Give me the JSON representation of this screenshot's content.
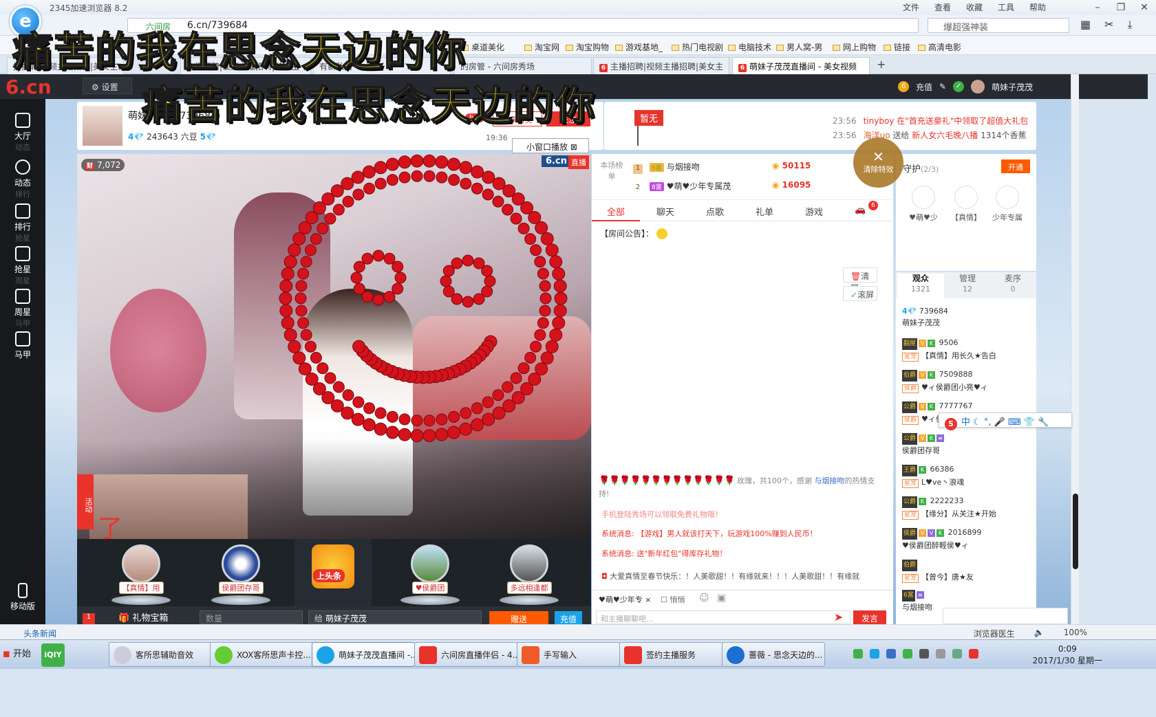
{
  "browser": {
    "title": "2345加速浏览器 8.2",
    "menu": [
      "文件",
      "查看",
      "收藏",
      "工具",
      "帮助"
    ],
    "address_tag": "六间房",
    "address": "6.cn/739684",
    "search_placeholder": "爆超强神装",
    "bookmarks": [
      "桌道美化",
      "淘宝网",
      "淘宝购物",
      "游戏基地_",
      "热门电视剧",
      "电脑技术",
      "男人窝-男",
      "网上购物",
      "链接",
      "高清电影"
    ],
    "tabs": [
      "播招聘|视频主播招聘|美女主",
      "主播招聘|视频主播招聘|美女主",
      "有新私信",
      "的房管 - 六间房秀场",
      "主播招聘|视频主播招聘|美女主",
      "萌妹子茂茂直播间 - 美女视频"
    ],
    "new_tab": "+"
  },
  "lyrics": {
    "line1": "痛苦的我在思念天边的你",
    "line2": "痛苦的我在思念天边的你"
  },
  "site": {
    "logo": "6.cn",
    "logo_small": "六间房",
    "settings": "设置",
    "user": {
      "recharge": "充值",
      "name": "萌妹子茂茂"
    }
  },
  "leftnav": [
    {
      "label": "大厅",
      "sub": "动态"
    },
    {
      "label": "动态",
      "sub": "排行"
    },
    {
      "label": "排行",
      "sub": "抢星"
    },
    {
      "label": "抢星",
      "sub": "周星"
    },
    {
      "label": "周星",
      "sub": "马甲"
    },
    {
      "label": "马甲",
      "sub": ""
    }
  ],
  "mobile": "移动版",
  "anchor": {
    "name": "萌妹子茂茂",
    "name_suffix": "(739684)",
    "level": "4",
    "beans": "243643 六豆",
    "crown": "5",
    "hot": "hot",
    "share": "分享有奖",
    "follow": "关注",
    "time": "19:36",
    "mini_window": "小窗口播放",
    "flag": "暂无"
  },
  "notices": [
    {
      "time": "23:56",
      "text": "tinyboy 在\"首充送豪礼\"中领取了超值大礼包"
    },
    {
      "time": "23:56",
      "user": "海洋uo",
      "text": "送给",
      "target": "新人女六毛晚八播",
      "gift": "1314个香蕉"
    }
  ],
  "video": {
    "viewers": "7,072",
    "watermark": "6.cn",
    "live": "直播",
    "activity": "活动",
    "caption_fragment": "了"
  },
  "fans": [
    {
      "label": "【真情】用"
    },
    {
      "label": "侯爵团存哥"
    },
    {
      "label": "上头条"
    },
    {
      "label": "♥侯爵团"
    },
    {
      "label": "多远相逢都"
    }
  ],
  "gift_bar": {
    "box": "礼物宝箱",
    "box_badge": "1",
    "qty_placeholder": "数量",
    "to_prefix": "给",
    "to": "萌妹子茂茂",
    "send": "赠送",
    "recharge": "充值"
  },
  "rank": {
    "label": "本场榜单",
    "rows": [
      {
        "no": "1",
        "badge": "6富",
        "name": "与烟接吻",
        "beans": "50115"
      },
      {
        "no": "2",
        "badge": "8富",
        "name": "♥萌♥少年专属茂",
        "beans": "16095"
      }
    ]
  },
  "chat_tabs": [
    "全部",
    "聊天",
    "点歌",
    "礼单",
    "游戏"
  ],
  "chat_badge": "6",
  "announcement": "【房间公告】：",
  "chat_controls": {
    "clear": "清屏",
    "scroll": "滚屏"
  },
  "chat_messages": {
    "rose_count": "玫瑰，共100个，感谢",
    "rose_user": "与烟接吻",
    "rose_tail": "的热情支持!",
    "sys1": "手机登陆秀场可以领取免费礼物哦！",
    "sys2": "系统消息: 【游戏】男人就该打天下，玩游戏100%赚到人民币！",
    "sys3": "系统消息: 送\"新年红包\"得库存礼物！",
    "broadcast": "大爱真情至春节快乐：！人美歌甜！！有缘就来！！！人美歌甜！！有缘就"
  },
  "chat_input": {
    "to": "♥萌♥少年专",
    "quiet": "悄悄",
    "placeholder": "和主播聊聊吧...",
    "send": "发言"
  },
  "guard": {
    "title": "守护",
    "count": "(2/3)",
    "open": "开通",
    "members": [
      "♥萌♥少",
      "【真情】",
      "少年专属"
    ]
  },
  "clear_effects": "清除特效",
  "audience_tabs": [
    {
      "label": "观众",
      "count": "1321"
    },
    {
      "label": "管理",
      "count": "12"
    },
    {
      "label": "麦序",
      "count": "0"
    }
  ],
  "audience": [
    {
      "id": "739684",
      "name": "萌妹子茂茂",
      "badge": "",
      "tag": ""
    },
    {
      "id": "9506",
      "name": "【真情】用长久★告白",
      "badge": "翻屋",
      "tag": "星宠"
    },
    {
      "id": "7509888",
      "name": "♥ィ侯爵团小亮♥ィ",
      "badge": "伯爵",
      "tag": "侯爵"
    },
    {
      "id": "7777767",
      "name": "♥ィ侯",
      "badge": "公爵",
      "tag": "侯爵"
    },
    {
      "id": "",
      "name": "侯爵团存哥",
      "badge": "公爵",
      "tag": ""
    },
    {
      "id": "66386",
      "name": "L♥ve丶浪魂",
      "badge": "王爵",
      "tag": "星宠"
    },
    {
      "id": "2222233",
      "name": "【缘分】从关注★开始",
      "badge": "公爵",
      "tag": "星宠"
    },
    {
      "id": "2016899",
      "name": "♥侯爵团醉輕侯♥ィ",
      "badge": "侯爵",
      "tag": ""
    },
    {
      "id": "",
      "name": "【曾今】唐★友",
      "badge": "伯爵",
      "tag": "星宠"
    },
    {
      "id": "",
      "name": "与烟接吻",
      "badge": "6富",
      "tag": ""
    }
  ],
  "ime": "中",
  "status": {
    "left": "头条新闻",
    "doctor": "浏览器医生",
    "zoom": "100%"
  },
  "taskbar": {
    "start": "开始",
    "apps": [
      "客所思辅助音效",
      "XOX客所思声卡控...",
      "萌妹子茂茂直播间 -...",
      "六间房直播伴侣 - 4...",
      "手写输入",
      "签约主播服务",
      "蔷薇 - 思念天边的..."
    ],
    "time": "0:09",
    "date": "2017/1/30 星期一"
  },
  "colors": {
    "brand_red": "#e8332b",
    "orange": "#ff5a00",
    "blue": "#1aa3e8"
  }
}
